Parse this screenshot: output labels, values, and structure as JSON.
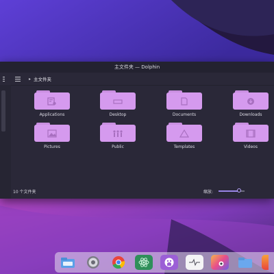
{
  "window": {
    "title": "主文件夹 — Dolphin"
  },
  "breadcrumb": {
    "current": "主文件夹"
  },
  "folders": [
    {
      "label": "Applications",
      "icon": "applications-icon"
    },
    {
      "label": "Desktop",
      "icon": "desktop-icon"
    },
    {
      "label": "Documents",
      "icon": "documents-icon"
    },
    {
      "label": "Downloads",
      "icon": "download-icon"
    },
    {
      "label": "Pictures",
      "icon": "pictures-icon"
    },
    {
      "label": "Public",
      "icon": "people-icon"
    },
    {
      "label": "Templates",
      "icon": "templates-icon"
    },
    {
      "label": "Videos",
      "icon": "video-icon"
    }
  ],
  "statusbar": {
    "count": "10 个文件夹",
    "zoom_label": "缩放:",
    "zoom_level": 0.8
  },
  "dock": {
    "apps": [
      "files-icon",
      "settings-icon",
      "chrome-icon",
      "atom-icon",
      "github-icon",
      "activity-monitor-icon",
      "photos-icon",
      "folder-icon",
      "launcher-icon"
    ]
  },
  "colors": {
    "folder": "#d59aee",
    "window_bg": "#2a2838",
    "accent": "#9a86e8"
  }
}
